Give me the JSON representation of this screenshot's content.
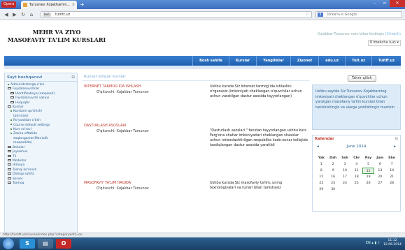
{
  "browser": {
    "menu_label": "Opera",
    "tab_title": "Turusnev Xojakhamin...",
    "url": "tumtt.uz",
    "url_badge": "Веб",
    "search_placeholder": "Искать в Google",
    "search_engine": "8"
  },
  "site": {
    "title_line1": "MEHR VA ZIYO",
    "title_line2": "MASOFAVIY TA'LIM KURSLARI",
    "login_text": "Xojakbar Tursunov nom bilan kirdingiz",
    "logout_link": "(Chiqish)",
    "language": "O'zbekcha (uz)"
  },
  "nav": {
    "items": [
      "Bosh sahifa",
      "Kurslar",
      "Yangiliklar",
      "Ziyonet",
      "edu.uz",
      "Tuit.uz",
      "Tuitff.uz"
    ]
  },
  "left_block": {
    "title": "Sayt boshqaruvi",
    "items": [
      {
        "label": "Administratorga e'lon",
        "type": "dot",
        "level": "l1"
      },
      {
        "label": "Foydalanuvchilar",
        "type": "fold",
        "level": "l1"
      },
      {
        "label": "Identifikatsiya (ampleah)",
        "type": "fold",
        "level": "l2"
      },
      {
        "label": "Foydalanuvchi vazuvi",
        "type": "fold",
        "level": "l2"
      },
      {
        "label": "Huquqlar",
        "type": "fold",
        "level": "l2"
      },
      {
        "label": "Kurslar",
        "type": "fold",
        "level": "l1"
      },
      {
        "label": "Kurslarni qo'shish/",
        "type": "dot",
        "level": "l2"
      },
      {
        "label": "tahrirlash",
        "type": "none",
        "level": "l3"
      },
      {
        "label": "Ro'yxatdan o'tish",
        "type": "dot",
        "level": "l2"
      },
      {
        "label": "Course default settings",
        "type": "dot",
        "level": "l2"
      },
      {
        "label": "Kurs so'rovi",
        "type": "dot",
        "level": "l2"
      },
      {
        "label": "Zaxira siftatida",
        "type": "dot",
        "level": "l2"
      },
      {
        "label": "saqlanganlar(Мах)alik",
        "type": "none",
        "level": "l3"
      },
      {
        "label": "maqsadida)",
        "type": "none",
        "level": "l3"
      },
      {
        "label": "Baholar",
        "type": "fold",
        "level": "l1"
      },
      {
        "label": "Joylashuv",
        "type": "fold",
        "level": "l1"
      },
      {
        "label": "Til",
        "type": "fold",
        "level": "l1"
      },
      {
        "label": "Modullar",
        "type": "fold",
        "level": "l1"
      },
      {
        "label": "Himoya",
        "type": "fold",
        "level": "l1"
      },
      {
        "label": "Tashqi ko'rinish",
        "type": "fold",
        "level": "l1"
      },
      {
        "label": "Oldingi sahifa",
        "type": "fold",
        "level": "l1"
      },
      {
        "label": "Server",
        "type": "fold",
        "level": "l1"
      },
      {
        "label": "Tarmoq",
        "type": "fold",
        "level": "l1"
      }
    ]
  },
  "main": {
    "title": "Ruxsat etilgan kurslar",
    "courses": [
      {
        "name": "INTERNET TARMOG'IDA ISHLASH",
        "teacher": "O'qituvchi: Xojakbar Tursunov",
        "summary": "Ushbu kursda Siz Internet tarmog'ida ishlashni o'rganasiz (imkoniyati cheklangan o'quvchilar uchun uchun varatilgan dastur asosida tayyorlangan)"
      },
      {
        "name": "DASTURLASH ASOSLARI",
        "teacher": "O'qituvchi: Xojakbar Tursunov",
        "summary": "\"Dasturlash asoslari \" fanidan tayyorlangan ushbu kurs Farg'ona shahar imkoniyatlari cheklangan shaxslar uchun ixtisoslashtirilgan respublika kasb-xunar kollejida tasdiqlangan dastur asosida yaratildi"
      },
      {
        "name": "MASOFAVIY TA'LIM HAQIDA",
        "teacher": "O'qituvchi: Xojakbar Tursunov",
        "summary": "Ushbu kursda Siz masofaviy ta'lim, uning texnologiyalari va turlari bilan tanishasiz"
      }
    ]
  },
  "right": {
    "edit_button": "Tahrir qilish",
    "info_text": "Ushbu saytda Siz Tursunov Xojakbarning imkoniyati cheklangan o'quvchilar uchun yaratgan masofaviy ta'lim kurslari bilan tanishishingiz va ularga yozilishingiz mumkin",
    "calendar": {
      "title": "Kalendar",
      "month": "June 2014",
      "prev": "◂",
      "next": "▸",
      "weekdays": [
        "Yak",
        "Dsh",
        "Ssh",
        "Chr",
        "Pay",
        "Jum",
        "Shn"
      ],
      "weeks": [
        [
          "1",
          "2",
          "3",
          "4",
          "5",
          "6",
          "7"
        ],
        [
          "8",
          "9",
          "10",
          "11",
          "12",
          "13",
          "14"
        ],
        [
          "15",
          "16",
          "17",
          "18",
          "19",
          "20",
          "21"
        ],
        [
          "22",
          "23",
          "24",
          "25",
          "26",
          "27",
          "28"
        ],
        [
          "29",
          "30",
          "",
          "",
          "",
          "",
          ""
        ]
      ],
      "today": "12"
    }
  },
  "status": {
    "url": "http://tumtt.uz/course/index.php?categoryedit=on"
  },
  "taskbar": {
    "apps": [
      "S",
      "▤",
      "O"
    ],
    "time": "11:12",
    "date": "12.06.2014",
    "locale": "EN"
  }
}
